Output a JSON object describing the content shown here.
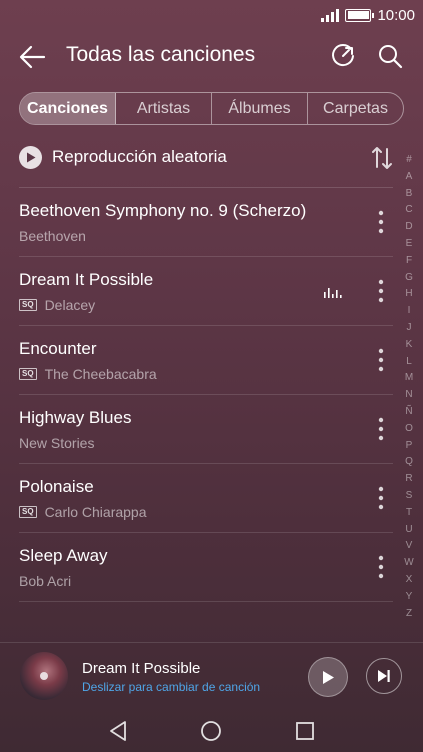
{
  "status_bar": {
    "time": "10:00",
    "signal_icon": "signal-icon",
    "battery_icon": "battery-icon"
  },
  "header": {
    "title": "Todas las canciones",
    "back_icon": "back-arrow-icon",
    "refresh_icon": "refresh-icon",
    "search_icon": "search-icon"
  },
  "tabs": [
    {
      "label": "Canciones",
      "active": true
    },
    {
      "label": "Artistas",
      "active": false
    },
    {
      "label": "Álbumes",
      "active": false
    },
    {
      "label": "Carpetas",
      "active": false
    }
  ],
  "shuffle": {
    "label": "Reproducción aleatoria",
    "play_icon": "play-icon",
    "sort_icon": "sort-icon"
  },
  "songs": [
    {
      "title": "Beethoven Symphony no. 9 (Scherzo)",
      "artist": "Beethoven",
      "sq": false,
      "playing": false
    },
    {
      "title": "Dream It Possible",
      "artist": "Delacey",
      "sq": true,
      "playing": true
    },
    {
      "title": "Encounter",
      "artist": "The Cheebacabra",
      "sq": true,
      "playing": false
    },
    {
      "title": "Highway Blues",
      "artist": "New Stories",
      "sq": false,
      "playing": false
    },
    {
      "title": "Polonaise",
      "artist": "Carlo Chiarappa",
      "sq": true,
      "playing": false
    },
    {
      "title": "Sleep Away",
      "artist": "Bob Acri",
      "sq": false,
      "playing": false
    }
  ],
  "sq_label": "SQ",
  "alphabet": [
    "#",
    "A",
    "B",
    "C",
    "D",
    "E",
    "F",
    "G",
    "H",
    "I",
    "J",
    "K",
    "L",
    "M",
    "N",
    "Ñ",
    "O",
    "P",
    "Q",
    "R",
    "S",
    "T",
    "U",
    "V",
    "W",
    "X",
    "Y",
    "Z"
  ],
  "mini_player": {
    "title": "Dream It Possible",
    "hint": "Deslizar para cambiar de canción",
    "play_icon": "play-icon",
    "next_icon": "skip-next-icon"
  },
  "nav_bar": {
    "back_icon": "nav-back-icon",
    "home_icon": "nav-home-icon",
    "recent_icon": "nav-recents-icon"
  },
  "colors": {
    "accent_link": "#4fa6e8",
    "background_top": "#6e3f4f",
    "background_bottom": "#3f2a33"
  }
}
